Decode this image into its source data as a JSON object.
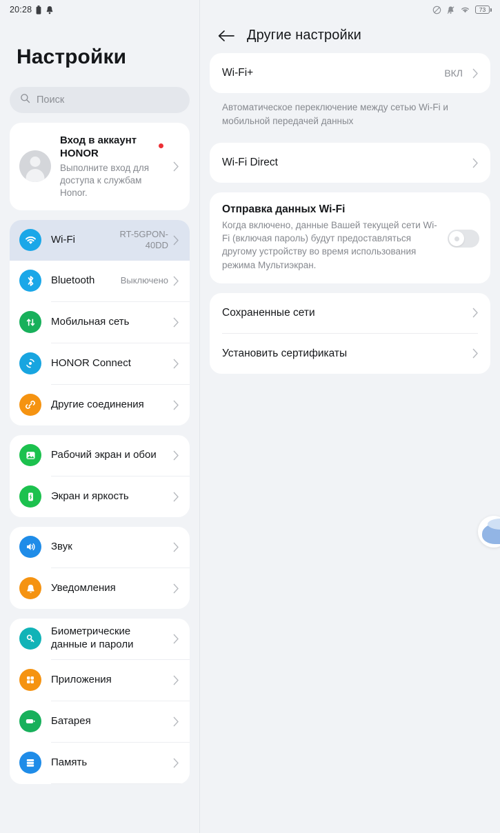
{
  "status_bar": {
    "time": "20:28",
    "left_icons": [
      "battery-icon",
      "bell-icon"
    ],
    "right_icons": [
      "data-saver-icon",
      "bell-muted-icon",
      "wifi-icon"
    ],
    "battery_percent": "73"
  },
  "sidebar": {
    "title": "Настройки",
    "search": {
      "placeholder": "Поиск",
      "icon": "search-icon"
    },
    "account": {
      "title": "Вход в аккаунт HONOR",
      "subtitle": "Выполните вход для доступа к службам Honor.",
      "has_badge": true,
      "avatar_icon": "person-icon"
    },
    "groups": [
      {
        "items": [
          {
            "label": "Wi-Fi",
            "value": "RT-5GPON-40DD",
            "icon": "wifi-icon",
            "color": "#1aa7e8",
            "selected": true
          },
          {
            "label": "Bluetooth",
            "value": "Выключено",
            "icon": "bluetooth-icon",
            "color": "#1aa7e8",
            "selected": false
          },
          {
            "label": "Мобильная сеть",
            "value": "",
            "icon": "mobile-data-icon",
            "color": "#18b05b",
            "selected": false
          },
          {
            "label": "HONOR Connect",
            "value": "",
            "icon": "honor-connect-icon",
            "color": "#18a5e0",
            "selected": false
          },
          {
            "label": "Другие соединения",
            "value": "",
            "icon": "link-icon",
            "color": "#f59311",
            "selected": false
          }
        ]
      },
      {
        "items": [
          {
            "label": "Рабочий экран и обои",
            "value": "",
            "icon": "wallpaper-icon",
            "color": "#1cc14e",
            "selected": false
          },
          {
            "label": "Экран и яркость",
            "value": "",
            "icon": "brightness-icon",
            "color": "#1cc14e",
            "selected": false
          }
        ]
      },
      {
        "items": [
          {
            "label": "Звук",
            "value": "",
            "icon": "speaker-icon",
            "color": "#1f8ce8",
            "selected": false
          },
          {
            "label": "Уведомления",
            "value": "",
            "icon": "bell-icon",
            "color": "#f59311",
            "selected": false
          }
        ]
      },
      {
        "items": [
          {
            "label": "Биометрические данные и пароли",
            "value": "",
            "icon": "key-icon",
            "color": "#11b3b7",
            "selected": false
          },
          {
            "label": "Приложения",
            "value": "",
            "icon": "apps-grid-icon",
            "color": "#f59311",
            "selected": false
          },
          {
            "label": "Батарея",
            "value": "",
            "icon": "battery-icon",
            "color": "#18b05b",
            "selected": false
          },
          {
            "label": "Память",
            "value": "",
            "icon": "storage-icon",
            "color": "#1f8ce8",
            "selected": false
          }
        ]
      }
    ]
  },
  "detail": {
    "back_icon": "back-arrow-icon",
    "title": "Другие настройки",
    "wifi_plus": {
      "label": "Wi-Fi+",
      "value": "ВКЛ"
    },
    "wifi_plus_desc": "Автоматическое переключение между сетью Wi-Fi и мобильной передачей данных",
    "wifi_direct": {
      "label": "Wi-Fi Direct"
    },
    "share": {
      "title": "Отправка данных Wi-Fi",
      "body": "Когда включено, данные Вашей текущей сети Wi-Fi (включая пароль) будут предоставляться другому устройству во время использования режима Мультиэкран.",
      "toggle_on": false
    },
    "saved_networks": {
      "label": "Сохраненные сети"
    },
    "install_certs": {
      "label": "Установить сертификаты"
    }
  }
}
